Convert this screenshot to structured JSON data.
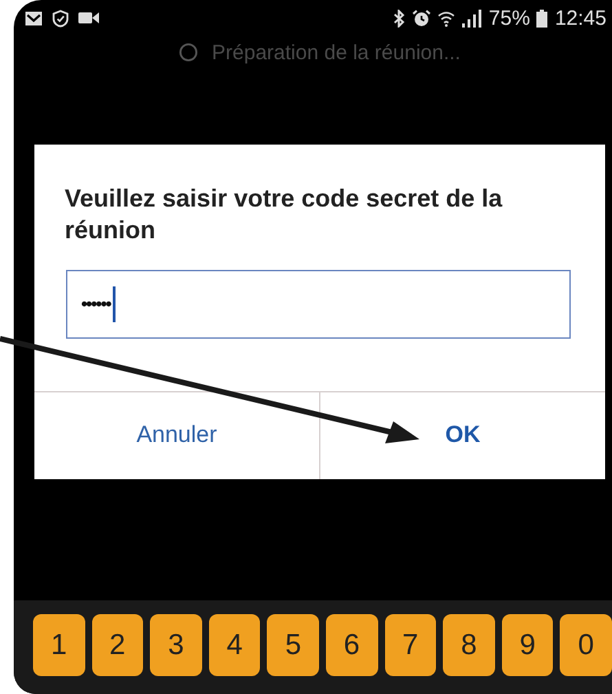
{
  "status_bar": {
    "battery": "75%",
    "time": "12:45"
  },
  "loading": {
    "text": "Préparation de la réunion..."
  },
  "dialog": {
    "title": "Veuillez saisir votre code secret de la réunion",
    "field": {
      "value": "••••••"
    },
    "buttons": [
      {
        "label": "Annuler",
        "kind": "cancel"
      },
      {
        "label": "OK",
        "kind": "confirm"
      }
    ]
  },
  "keyboard": {
    "keys": [
      "1",
      "2",
      "3",
      "4",
      "5",
      "6",
      "7",
      "8",
      "9",
      "0"
    ]
  }
}
